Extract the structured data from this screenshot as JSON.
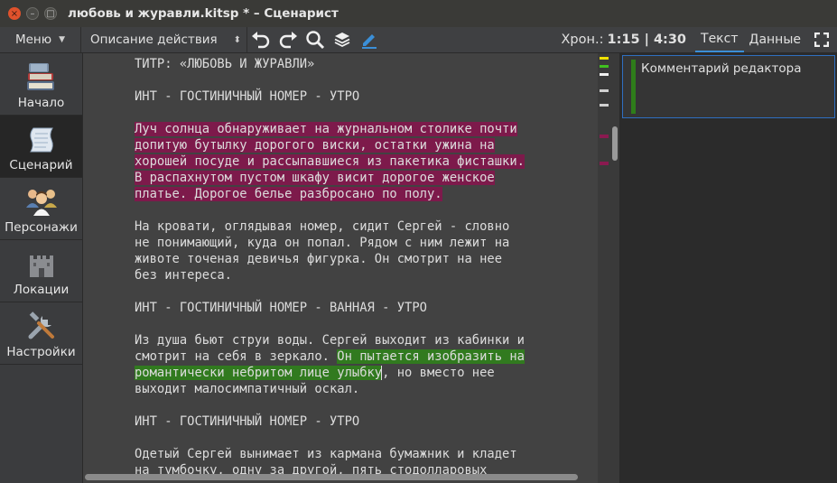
{
  "window": {
    "title": "любовь и журавли.kitsp * – Сценарист",
    "controls": {
      "close": "×",
      "minimize": "–",
      "maximize": "□"
    }
  },
  "toolbar": {
    "menu_label": "Меню",
    "block_type": "Описание действия",
    "chron_label": "Хрон.:",
    "chron_value": "1:15 | 4:30",
    "tabs": [
      {
        "label": "Текст",
        "active": true
      },
      {
        "label": "Данные",
        "active": false
      }
    ],
    "icons": [
      "undo-icon",
      "redo-icon",
      "search-icon",
      "layers-icon",
      "pen-icon",
      "fullscreen-icon"
    ]
  },
  "sidebar": {
    "items": [
      {
        "label": "Начало",
        "icon": "books-icon",
        "active": false
      },
      {
        "label": "Сценарий",
        "icon": "scroll-icon",
        "active": true
      },
      {
        "label": "Персонажи",
        "icon": "people-icon",
        "active": false
      },
      {
        "label": "Локации",
        "icon": "castle-icon",
        "active": false
      },
      {
        "label": "Настройки",
        "icon": "tools-icon",
        "active": false
      }
    ]
  },
  "script": {
    "title_line": "ТИТР: «ЛЮБОВЬ И ЖУРАВЛИ»",
    "scene1": "ИНТ - ГОСТИНИЧНЫЙ НОМЕР - УТРО",
    "para1": [
      "Луч солнца обнаруживает на журнальном столике почти",
      "допитую бутылку дорогого виски, остатки ужина на",
      "хорошей посуде и рассыпавшиеся из пакетика фисташки.",
      "В распахнутом пустом шкафу висит дорогое женское",
      "платье. Дорогое белье разбросано по полу."
    ],
    "para2": [
      "На кровати, оглядывая номер, сидит Сергей - словно",
      "не понимающий, куда он попал. Рядом с ним лежит на",
      "животе точеная девичья фигурка. Он смотрит на нее",
      "без интереса."
    ],
    "scene2": "ИНТ - ГОСТИНИЧНЫЙ НОМЕР - ВАННАЯ - УТРО",
    "para3": {
      "line1": "Из душа бьют струи воды. Сергей выходит из кабинки и",
      "line2_plain": "смотрит на себя в зеркало. ",
      "line2_hl": "Он пытается изобразить на",
      "line3_hl": "романтически небритом лице улыбку",
      "line3_plain": ", но вместо нее",
      "line4": "выходит малосимпатичный оскал."
    },
    "scene3": "ИНТ - ГОСТИНИЧНЫЙ НОМЕР - УТРО",
    "para4": [
      "Одетый Сергей вынимает из кармана бумажник и кладет",
      "на тумбочку, одну за другой, пять стодолларовых"
    ]
  },
  "colors": {
    "highlight_red": "#7d1a4b",
    "highlight_green": "#317a1f",
    "accent_blue": "#3b8fd8"
  },
  "comments": [
    {
      "text": "Комментарий редактора",
      "color": "#2e7d1a"
    }
  ]
}
